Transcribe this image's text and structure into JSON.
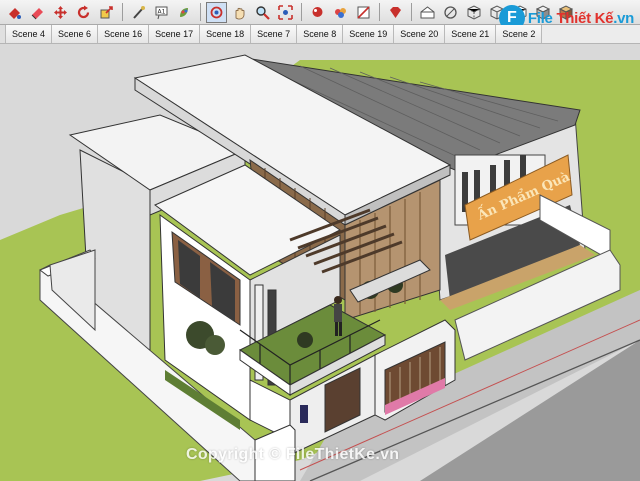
{
  "toolbar": {
    "icons": [
      "paint-bucket-icon",
      "eraser-icon",
      "move-icon",
      "rotate-icon",
      "scale-icon",
      "follow-me-icon",
      "text-icon",
      "paint-icon",
      "orbit-icon",
      "pan-icon",
      "zoom-icon",
      "zoom-extents-icon",
      "shadow-icon",
      "fog-icon",
      "section-icon",
      "ruby-icon",
      "style-icon",
      "xray-icon",
      "back-edges-icon",
      "wireframe-icon",
      "hidden-line-icon",
      "shaded-icon",
      "textured-icon"
    ]
  },
  "logo": {
    "mark": "F",
    "name": "File",
    "accent": "Thiết Kế",
    "suffix": ".vn"
  },
  "scenes": [
    "Scene 4",
    "Scene 6",
    "Scene 16",
    "Scene 17",
    "Scene 18",
    "Scene 7",
    "Scene 8",
    "Scene 19",
    "Scene 20",
    "Scene 21",
    "Scene 2"
  ],
  "sign_text": "Ấn Phẩm Quà",
  "watermark": "Copyright © FileThietKe.vn",
  "colors": {
    "grass": "#a8c454",
    "road": "#9a9a9a",
    "roof": "#ececec",
    "sky": "#d9d9d9",
    "accent": "#1a9bd7"
  }
}
